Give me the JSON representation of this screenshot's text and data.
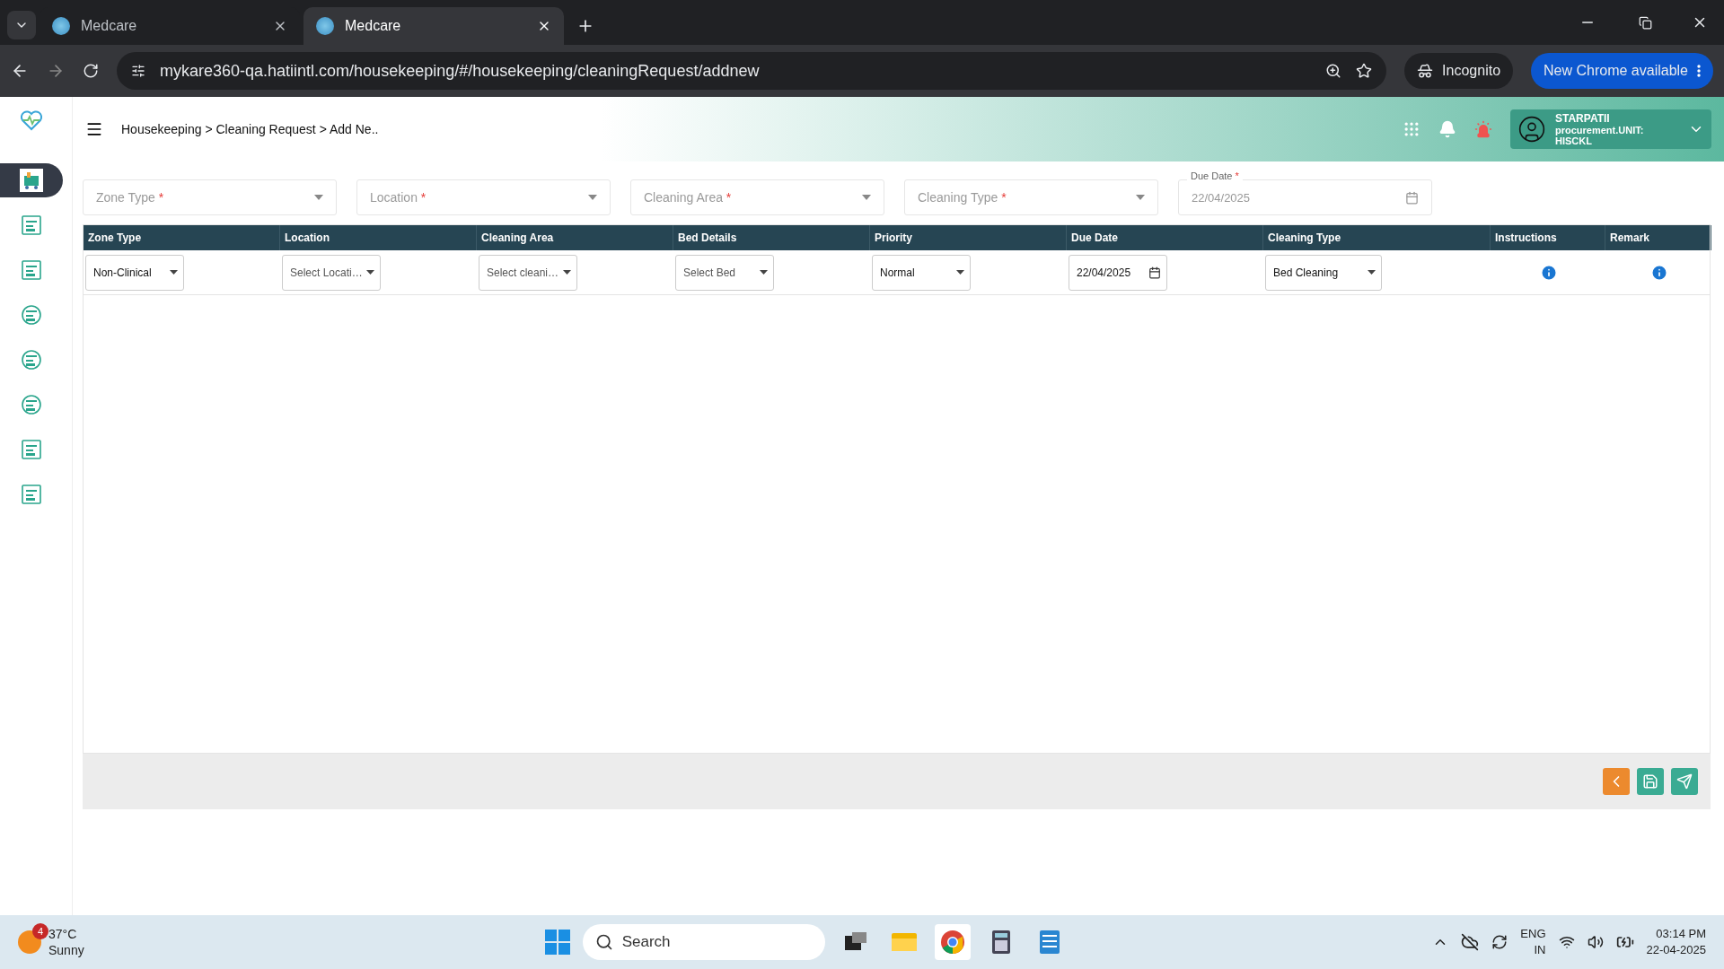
{
  "browser": {
    "tabs": [
      {
        "title": "Medcare",
        "selected": false
      },
      {
        "title": "Medcare",
        "selected": true
      }
    ],
    "url": "mykare360-qa.hatiintl.com/housekeeping/#/housekeeping/cleaningRequest/addnew",
    "incognito": "Incognito",
    "update": "New Chrome available"
  },
  "header": {
    "breadcrumb": "Housekeeping > Cleaning Request > Add Ne..",
    "user": {
      "name": "STARPATII",
      "unit": "procurement.UNIT: HISCKL"
    }
  },
  "sidebar": {
    "items": [
      {
        "selected": true
      },
      {
        "selected": false
      },
      {
        "selected": false
      },
      {
        "selected": false
      },
      {
        "selected": false
      },
      {
        "selected": false
      },
      {
        "selected": false
      },
      {
        "selected": false
      }
    ]
  },
  "filters": [
    {
      "kind": "select",
      "label": "Zone Type",
      "required_mark": "*"
    },
    {
      "kind": "select",
      "label": "Location",
      "required_mark": "*"
    },
    {
      "kind": "select",
      "label": "Cleaning Area",
      "required_mark": "*"
    },
    {
      "kind": "select",
      "label": "Cleaning Type",
      "required_mark": "*"
    },
    {
      "kind": "date",
      "label": "Due Date",
      "required_mark": "*",
      "value": "22/04/2025"
    }
  ],
  "table": {
    "columns": [
      "Zone Type",
      "Location",
      "Cleaning Area",
      "Bed Details",
      "Priority",
      "Due Date",
      "Cleaning Type",
      "Instructions",
      "Remark"
    ],
    "rows": [
      {
        "cells": [
          {
            "kind": "select",
            "value": "Non-Clinical"
          },
          {
            "kind": "select",
            "placeholder": "Select Locati…"
          },
          {
            "kind": "select",
            "placeholder": "Select cleani…"
          },
          {
            "kind": "select",
            "placeholder": "Select Bed"
          },
          {
            "kind": "select",
            "value": "Normal"
          },
          {
            "kind": "date",
            "value": "22/04/2025"
          },
          {
            "kind": "select",
            "value": "Bed Cleaning"
          },
          {
            "kind": "info"
          },
          {
            "kind": "info"
          }
        ]
      }
    ]
  },
  "taskbar": {
    "badge": "4",
    "temperature": "37°C",
    "condition": "Sunny",
    "search": "Search",
    "language": "ENG",
    "region": "IN",
    "time": "03:14 PM",
    "date": "22-04-2025"
  }
}
